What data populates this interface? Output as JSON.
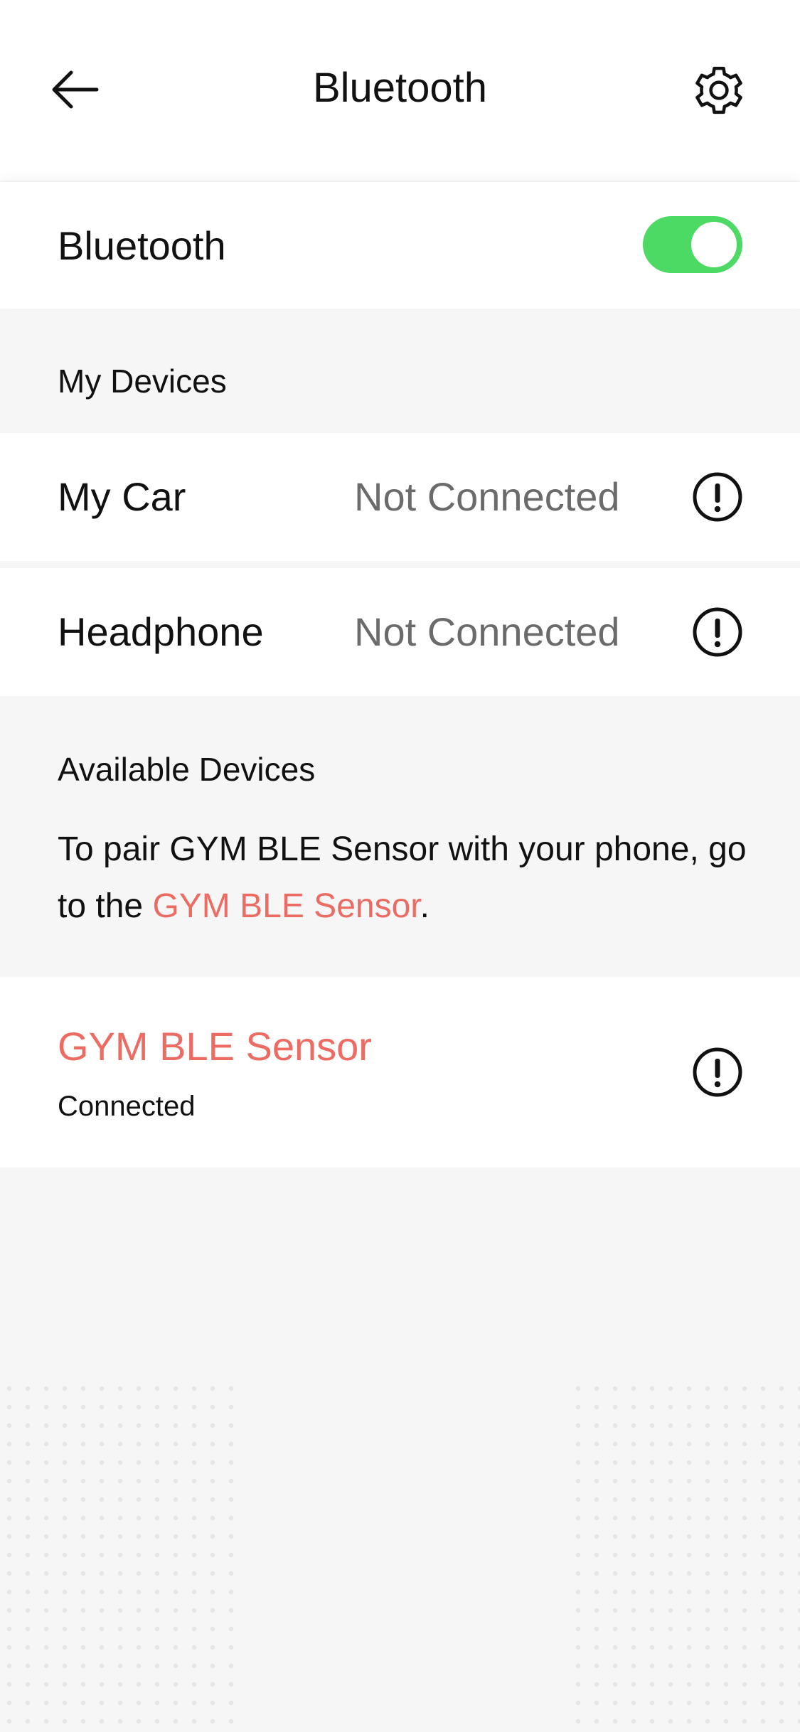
{
  "header": {
    "title": "Bluetooth",
    "back_icon": "arrow-left-icon",
    "settings_icon": "gear-icon"
  },
  "bluetooth": {
    "label": "Bluetooth",
    "enabled": true,
    "toggle_color": "#4cd964"
  },
  "my_devices": {
    "title": "My Devices",
    "items": [
      {
        "name": "My Car",
        "status": "Not Connected",
        "icon": "info-icon"
      },
      {
        "name": "Headphone",
        "status": "Not Connected",
        "icon": "info-icon"
      }
    ]
  },
  "available_devices": {
    "title": "Available Devices",
    "pair_text_prefix": "To pair GYM BLE Sensor with your phone, go to the ",
    "pair_link": "GYM BLE Sensor",
    "pair_text_suffix": ".",
    "items": [
      {
        "name": "GYM BLE Sensor",
        "status": "Connected",
        "icon": "info-icon"
      }
    ]
  },
  "colors": {
    "accent": "#ec6b62",
    "status_gray": "#6b6b6b",
    "background": "#f6f6f6"
  }
}
